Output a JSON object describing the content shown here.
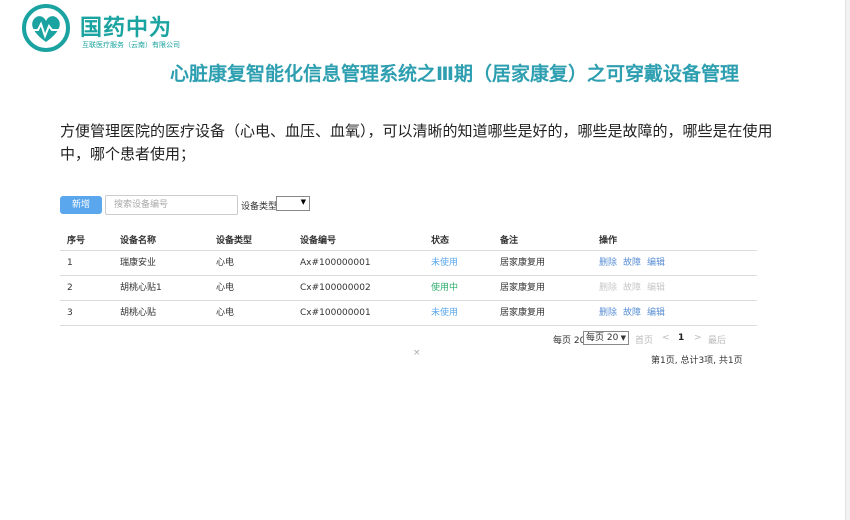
{
  "logo": {
    "name": "国药中为",
    "subtitle": "互联医疗服务（云南）有限公司"
  },
  "page_title": "心脏康复智能化信息管理系统之Ⅲ期（居家康复）之可穿戴设备管理",
  "description": "方便管理医院的医疗设备（心电、血压、血氧），可以清晰的知道哪些是好的，哪些是故障的，哪些是在使用中，哪个患者使用；",
  "toolbar": {
    "new_label": "新增",
    "search_placeholder": "搜索设备编号",
    "type_label": "设备类型",
    "type_value": ""
  },
  "table": {
    "headers": [
      "序号",
      "设备名称",
      "设备类型",
      "设备编号",
      "状态",
      "备注",
      "操作"
    ],
    "rows": [
      {
        "index": "1",
        "name": "瑞康安业",
        "type": "心电",
        "code": "Ax#100000001",
        "status": "未使用",
        "note": "居家康复用",
        "actions": [
          "删除",
          "故障",
          "编辑"
        ]
      },
      {
        "index": "2",
        "name": "胡桃心贴1",
        "type": "心电",
        "code": "Cx#100000002",
        "status": "使用中",
        "note": "居家康复用",
        "actions": [
          "删除",
          "故障",
          "编辑"
        ]
      },
      {
        "index": "3",
        "name": "胡桃心贴",
        "type": "心电",
        "code": "Cx#100000001",
        "status": "未使用",
        "note": "居家康复用",
        "actions": [
          "删除",
          "故障",
          "编辑"
        ]
      }
    ]
  },
  "pagination": {
    "per_page_label": "每页 20",
    "per_page_select": "每页 20",
    "first": "首页",
    "prev": "<",
    "current": "1",
    "next": ">",
    "last": "最后",
    "summary": "第1页, 总计3项, 共1页"
  },
  "close_glyph": "×",
  "colors": {
    "brand": "#1aa3a0",
    "title": "#2d9fb0",
    "primary_button": "#5aa7ee",
    "status_idle": "#5aa7ee",
    "status_in_use": "#2fae6d",
    "action_link": "#5a8fd6",
    "action_disabled": "#c8c8c8"
  }
}
